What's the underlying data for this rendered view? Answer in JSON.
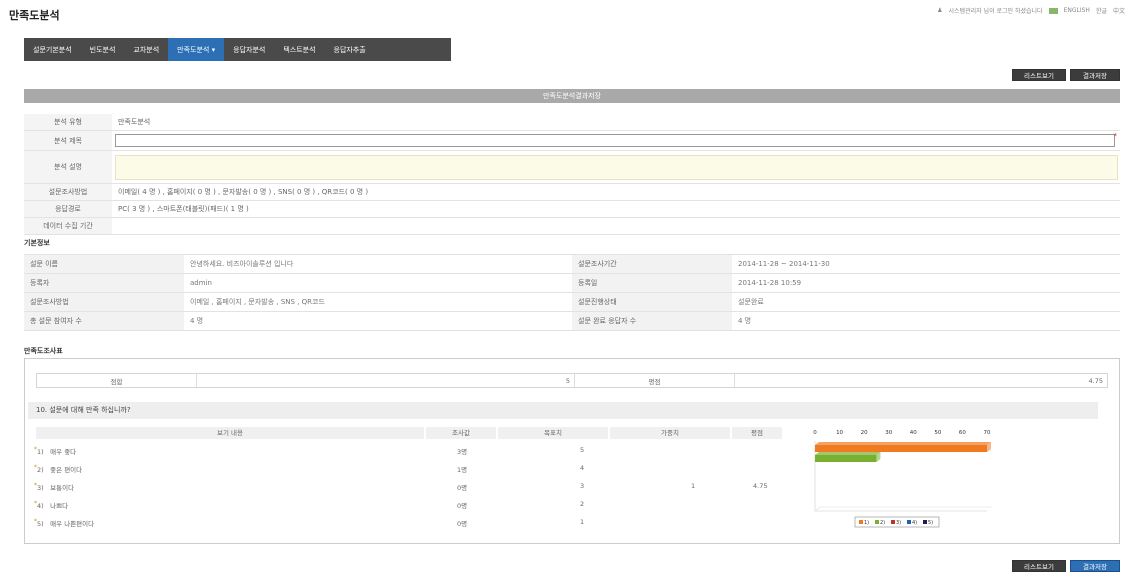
{
  "header": {
    "title": "만족도분석",
    "login_msg": "시스템관리자 님이 로그인 하셨습니다",
    "lang_en": "ENGLISH",
    "lang_ko": "한글",
    "lang_zh": "中文"
  },
  "nav": [
    "설문기본분석",
    "빈도분석",
    "교차분석",
    "만족도분석 ▾",
    "응답자분석",
    "텍스트분석",
    "응답자추출"
  ],
  "buttons": {
    "list": "리스트보기",
    "save": "결과저장"
  },
  "band_title": "만족도분석결과저장",
  "form": {
    "type_label": "분석 유형",
    "type_value": "만족도분석",
    "subject_label": "분석 제목",
    "subject_value": "",
    "desc_label": "분석 설명",
    "desc_value": "",
    "method_label": "설문조사방법",
    "method_value": "이메일( 4 명 ) , 홈페이지( 0 명 ) , 문자발송( 0 명 ) , SNS( 0 명 ) , QR코드( 0 명 )",
    "route_label": "응답경로",
    "route_value": "PC( 3 명 ) , 스마트폰(태블릿)(패드)( 1 명 )",
    "period_label": "데이터 수집 기간",
    "period_value": ""
  },
  "basic": {
    "section": "기본정보",
    "rows": [
      [
        "설문 이름",
        "안녕하세요. 비즈아이솔루션 입니다",
        "설문조사기간",
        "2014-11-28 ~ 2014-11-30"
      ],
      [
        "등록자",
        "admin",
        "등록일",
        "2014-11-28 10:59"
      ],
      [
        "설문조사방법",
        "이메일 , 홈페이지 , 문자발송 , SNS , QR코드",
        "설문진행상태",
        "설문완료"
      ],
      [
        "총 설문 참여자 수",
        "4 명",
        "설문 완료 응답자 수",
        "4 명"
      ]
    ]
  },
  "result": {
    "section": "만족도조사표",
    "sum_label1": "점합",
    "sum_val1": "5",
    "sum_label2": "평점",
    "sum_val2": "4.75",
    "question": "10. 설문에 대해 만족 하십니까?",
    "headers": [
      "보기 내용",
      "조사값",
      "목표치",
      "가중치",
      "평점"
    ],
    "rows": [
      {
        "label": "1)　매우 좋다",
        "count": "3명",
        "target": "5",
        "weight": "",
        "score": ""
      },
      {
        "label": "2)　좋은 편이다",
        "count": "1명",
        "target": "4",
        "weight": "",
        "score": ""
      },
      {
        "label": "3)　보통이다",
        "count": "0명",
        "target": "3",
        "weight": "1",
        "score": "4.75"
      },
      {
        "label": "4)　나쁘다",
        "count": "0명",
        "target": "2",
        "weight": "",
        "score": ""
      },
      {
        "label": "5)　매우 나쁜편이다",
        "count": "0명",
        "target": "1",
        "weight": "",
        "score": ""
      }
    ]
  },
  "chart_data": {
    "type": "bar",
    "orientation": "horizontal",
    "x_ticks": [
      "0",
      "10",
      "20",
      "30",
      "40",
      "50",
      "60",
      "70"
    ],
    "xlim": [
      0,
      70
    ],
    "series": [
      {
        "name": "1)",
        "value": 75,
        "color": "#f07a20"
      },
      {
        "name": "2)",
        "value": 25,
        "color": "#7ab030"
      },
      {
        "name": "3)",
        "value": 0,
        "color": "#c03030"
      },
      {
        "name": "4)",
        "value": 0,
        "color": "#2060b0"
      },
      {
        "name": "5)",
        "value": 0,
        "color": "#202050"
      }
    ],
    "legend": "bottom"
  }
}
